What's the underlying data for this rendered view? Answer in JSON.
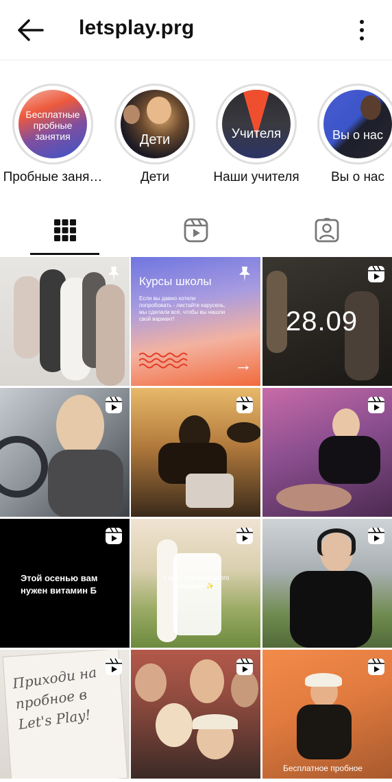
{
  "header": {
    "title": "letsplay.prg"
  },
  "highlights": [
    {
      "label": "Пробные заня…",
      "cover_text": "Бесплатные пробные занятия"
    },
    {
      "label": "Дети",
      "cover_text": "Дети"
    },
    {
      "label": "Наши учителя",
      "cover_text": "Учителя"
    },
    {
      "label": "Вы о нас",
      "cover_text": "Вы о нас"
    }
  ],
  "tabs": [
    {
      "name": "grid",
      "icon": "grid-icon",
      "active": true
    },
    {
      "name": "reels",
      "icon": "reels-icon",
      "active": false
    },
    {
      "name": "tagged",
      "icon": "tagged-icon",
      "active": false
    }
  ],
  "posts": [
    {
      "kind": "pinned"
    },
    {
      "kind": "pinned",
      "title": "Курсы школы",
      "body": "Если вы давно хотели попробовать - листайте карусель, мы сделали всё, чтобы вы нашли свой вариант!",
      "arrow": "→"
    },
    {
      "kind": "reel",
      "overlay": "28.09"
    },
    {
      "kind": "reel"
    },
    {
      "kind": "reel"
    },
    {
      "kind": "reel"
    },
    {
      "kind": "reel",
      "overlay": "Этой осенью вам нужен витамин Б"
    },
    {
      "kind": "reel",
      "overlay": "3 идеи для идеального свидания ✨"
    },
    {
      "kind": "reel"
    },
    {
      "kind": "reel",
      "note": "Приходи на пробное в Let's Play!"
    },
    {
      "kind": "reel"
    },
    {
      "kind": "reel",
      "overlay": "Бесплатное пробное"
    }
  ],
  "colors": {
    "accent_blue": "#3b55c9",
    "accent_orange": "#f0522f",
    "divider": "#ececec"
  }
}
